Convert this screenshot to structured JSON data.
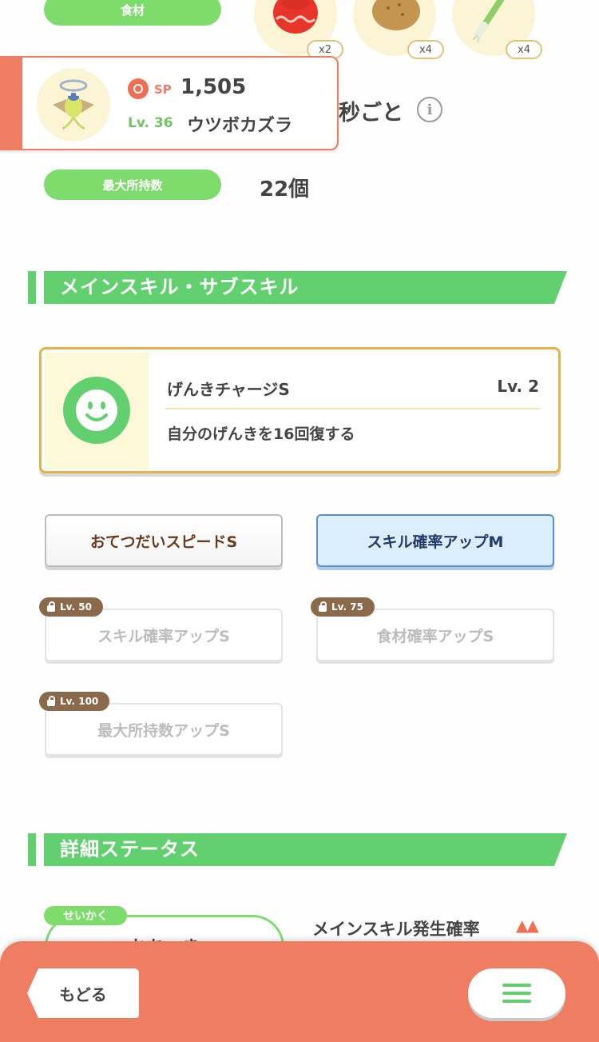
{
  "ingredients": {
    "label": "食材",
    "items": [
      {
        "icon": "tomato-icon",
        "count": "x2"
      },
      {
        "icon": "potato-icon",
        "count": "x4"
      },
      {
        "icon": "leek-icon",
        "count": "x4"
      }
    ]
  },
  "pokemon_card": {
    "sp_label": "SP",
    "sp_value": "1,505",
    "level": "Lv. 36",
    "name": "ウツボカズラ"
  },
  "frequency_partial": "秒ごと",
  "max_carry": {
    "label": "最大所持数",
    "value": "22個"
  },
  "skills_section": {
    "title": "メインスキル・サブスキル",
    "main_skill": {
      "name": "げんきチャージS",
      "level": "Lv. 2",
      "description": "自分のげんきを16回復する"
    },
    "sub_skills": [
      {
        "name": "おてつだいスピードS",
        "locked": false
      },
      {
        "name": "スキル確率アップM",
        "locked": false
      },
      {
        "name": "スキル確率アップS",
        "unlock": "Lv. 50",
        "locked": true
      },
      {
        "name": "食材確率アップS",
        "unlock": "Lv. 75",
        "locked": true
      },
      {
        "name": "最大所持数アップS",
        "unlock": "Lv. 100",
        "locked": true
      }
    ]
  },
  "details_section": {
    "title": "詳細ステータス",
    "nature_label": "せいかく",
    "nature_value": "おちつき",
    "stat_label": "メインスキル発生確率",
    "stat_arrows": "▲▲"
  },
  "bottom_bar": {
    "back_label": "もどる"
  },
  "colors": {
    "green": "#63d06f",
    "pill_green": "#7ddc6b",
    "orange": "#ef7d62",
    "gold_border": "#e8b24a",
    "brown_text": "#6a3a1c"
  }
}
